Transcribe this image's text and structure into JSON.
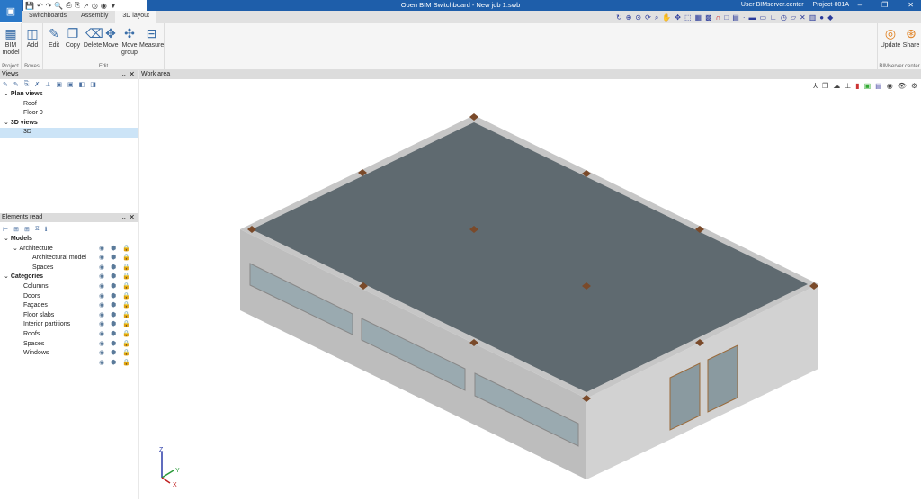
{
  "app": {
    "title": "Open BIM Switchboard - New job 1.swb",
    "user": "User BIMserver.center",
    "project": "Project-001A"
  },
  "tabs": [
    {
      "label": "Switchboards"
    },
    {
      "label": "Assembly"
    },
    {
      "label": "3D layout"
    }
  ],
  "ribbon": {
    "groups": [
      {
        "label": "Project"
      },
      {
        "label": "Boxes"
      },
      {
        "label": "Edit"
      },
      {
        "label": "BIMserver.center"
      }
    ],
    "buttons": {
      "bim_model": "BIM model",
      "add": "Add",
      "edit": "Edit",
      "copy": "Copy",
      "delete": "Delete",
      "move": "Move",
      "move_group": "Move group",
      "measure": "Measure",
      "update": "Update",
      "share": "Share"
    }
  },
  "views": {
    "title": "Views",
    "tree": [
      {
        "label": "Plan views"
      },
      {
        "label": "Roof"
      },
      {
        "label": "Floor 0"
      },
      {
        "label": "3D views"
      },
      {
        "label": "3D"
      }
    ]
  },
  "work_area": {
    "title": "Work area"
  },
  "elements": {
    "title": "Elements read",
    "tree": [
      {
        "label": "Models"
      },
      {
        "label": "Architecture"
      },
      {
        "label": "Architectural model"
      },
      {
        "label": "Spaces"
      },
      {
        "label": "Categories"
      },
      {
        "label": "Columns"
      },
      {
        "label": "Doors"
      },
      {
        "label": "Façades"
      },
      {
        "label": "Floor slabs"
      },
      {
        "label": "Interior partitions"
      },
      {
        "label": "Roofs"
      },
      {
        "label": "Spaces"
      },
      {
        "label": "Windows"
      }
    ]
  },
  "axes": {
    "x": "X",
    "y": "Y",
    "z": "Z"
  },
  "colors": {
    "titlebar": "#1e5eaa",
    "roof": "#5f6a70",
    "wall": "#c8c8c8",
    "column": "#7a4a2a"
  }
}
